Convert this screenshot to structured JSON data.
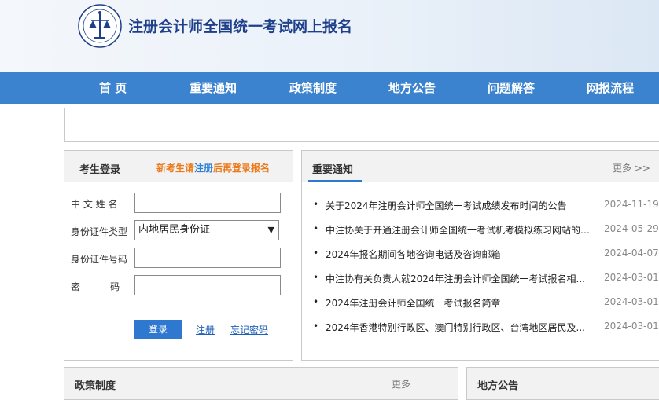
{
  "header": {
    "site_title": "注册会计师全国统一考试网上报名",
    "logo_icon": "cicpa-emblem-icon"
  },
  "nav": {
    "items": [
      {
        "label": "首  页"
      },
      {
        "label": "重要通知"
      },
      {
        "label": "政策制度"
      },
      {
        "label": "地方公告"
      },
      {
        "label": "问题解答"
      },
      {
        "label": "网报流程"
      }
    ]
  },
  "login": {
    "title": "考生登录",
    "hint_prefix": "新考生请",
    "hint_link": "注册",
    "hint_suffix": "后再登录报名",
    "fields": {
      "name_label": "中 文  姓 名",
      "name_value": "",
      "id_type_label": "身份证件类型",
      "id_type_selected": "内地居民身份证",
      "id_number_label": "身份证件号码",
      "id_number_value": "",
      "password_label": "密          码",
      "password_value": ""
    },
    "login_button": "登录",
    "register_link": "注册",
    "forgot_link": "忘记密码"
  },
  "news": {
    "title": "重要通知",
    "more_label": "更多 >>",
    "items": [
      {
        "text": "关于2024年注册会计师全国统一考试成绩发布时间的公告",
        "date": "2024-11-19"
      },
      {
        "text": "中注协关于开通注册会计师全国统一考试机考模拟练习网站的公...",
        "date": "2024-05-29"
      },
      {
        "text": "2024年报名期间各地咨询电话及咨询邮箱",
        "date": "2024-04-07"
      },
      {
        "text": "中注协有关负责人就2024年注册会计师全国统一考试报名相...",
        "date": "2024-03-01"
      },
      {
        "text": "2024年注册会计师全国统一考试报名简章",
        "date": "2024-03-01"
      },
      {
        "text": "2024年香港特别行政区、澳门特别行政区、台湾地区居民及...",
        "date": "2024-03-01"
      }
    ]
  },
  "bottom": {
    "left_title": "政策制度",
    "left_more": "更多",
    "right_title": "地方公告"
  },
  "colors": {
    "nav_bg": "#3b83cf",
    "title_blue": "#1e3f8a",
    "hint_orange": "#ec7a1b",
    "button_blue": "#2f78cf"
  }
}
